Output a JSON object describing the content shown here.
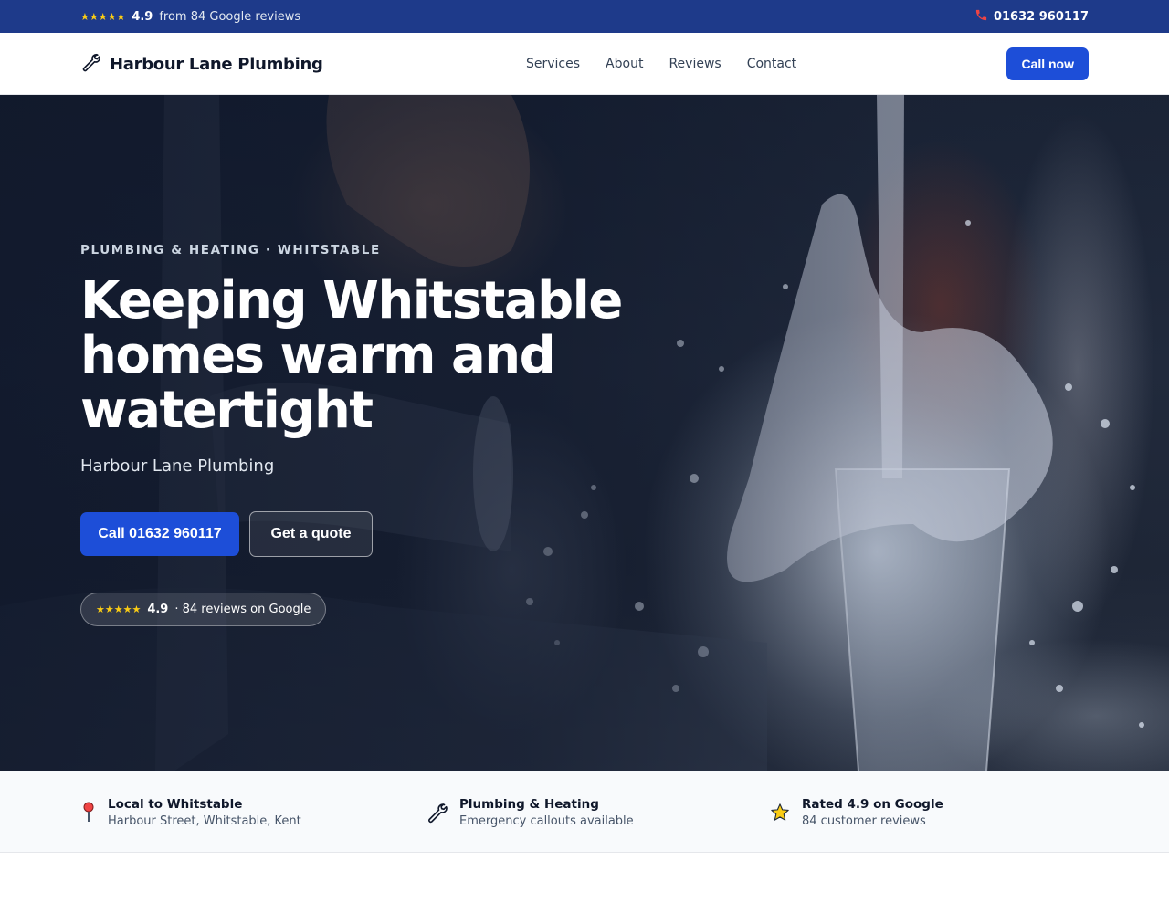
{
  "topbar": {
    "stars": "★★★★★",
    "rating": "4.9",
    "reviews_text": "from 84 Google reviews",
    "phone": "01632 960117"
  },
  "header": {
    "brand": "Harbour Lane Plumbing",
    "nav": [
      "Services",
      "About",
      "Reviews",
      "Contact"
    ],
    "cta": "Call now"
  },
  "hero": {
    "eyebrow": "PLUMBING & HEATING · WHITSTABLE",
    "title": "Keeping Whitstable homes warm and watertight",
    "subtitle": "Harbour Lane Plumbing",
    "primary_cta": "Call 01632 960117",
    "secondary_cta": "Get a quote",
    "badge_stars": "★★★★★",
    "badge_rating": "4.9",
    "badge_text": "· 84 reviews on Google"
  },
  "features": [
    {
      "title": "Local to Whitstable",
      "desc": "Harbour Street, Whitstable, Kent",
      "icon": "map-pin-icon"
    },
    {
      "title": "Plumbing & Heating",
      "desc": "Emergency callouts available",
      "icon": "wrench-icon"
    },
    {
      "title": "Rated 4.9 on Google",
      "desc": "84 customer reviews",
      "icon": "star-icon"
    }
  ],
  "colors": {
    "topbar_bg": "#1e3a8a",
    "primary": "#1d4ed8",
    "star": "#facc15"
  }
}
